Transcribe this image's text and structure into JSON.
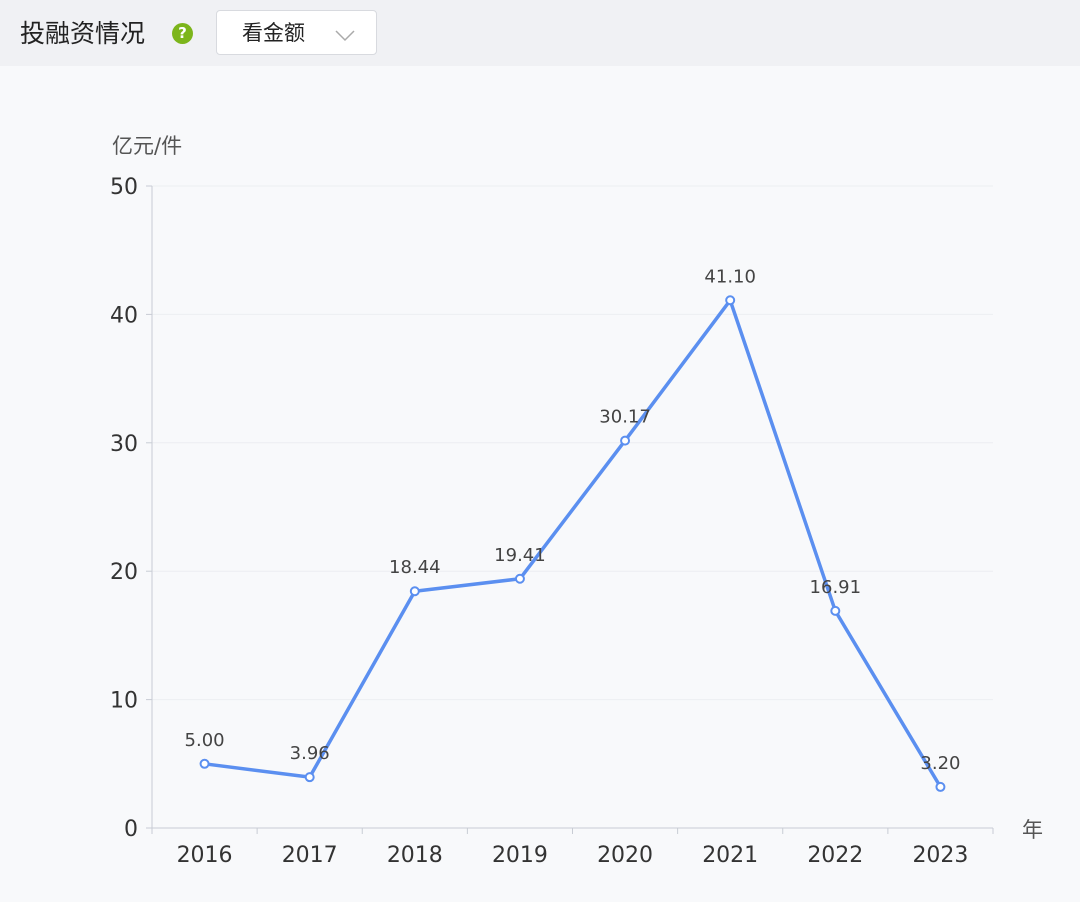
{
  "header": {
    "title": "投融资情况",
    "help_icon": "question-circle-icon",
    "select": {
      "value": "看金额",
      "icon": "chevron-down-icon"
    }
  },
  "colors": {
    "line": "#5b8ff0",
    "help": "#7cb51b",
    "axis": "#c8ccd4",
    "grid": "#eceef2"
  },
  "chart_data": {
    "type": "line",
    "title": "",
    "ylabel": "亿元/件",
    "xlabel": "年",
    "categories": [
      "2016",
      "2017",
      "2018",
      "2019",
      "2020",
      "2021",
      "2022",
      "2023"
    ],
    "series": [
      {
        "values": [
          5.0,
          3.96,
          18.44,
          19.41,
          30.17,
          41.1,
          16.91,
          3.2
        ]
      }
    ],
    "data_labels": [
      "5.00",
      "3.96",
      "18.44",
      "19.41",
      "30.17",
      "41.10",
      "16.91",
      "3.20"
    ],
    "yticks": [
      0,
      10,
      20,
      30,
      40,
      50
    ],
    "ylim": [
      0,
      50
    ],
    "grid": true,
    "legend": "none"
  }
}
